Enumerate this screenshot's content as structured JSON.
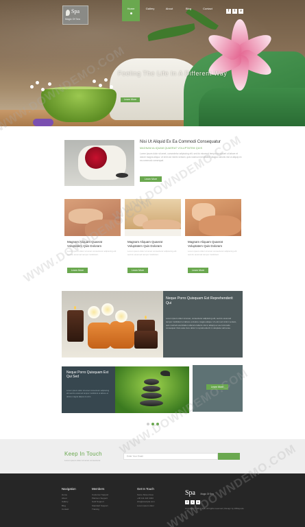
{
  "brand": {
    "name": "Spa",
    "tagline": "Magic Of Sea"
  },
  "nav": [
    {
      "label": "Home"
    },
    {
      "label": "Gallery"
    },
    {
      "label": "About"
    },
    {
      "label": "Blog"
    },
    {
      "label": "Contact"
    }
  ],
  "social": [
    "f",
    "t",
    "v"
  ],
  "hero": {
    "title": "Feeling The Life In A Different Way",
    "button": "Learn More"
  },
  "feature": {
    "title": "Nisi Ut Aliquid Ex Ea Commodi Consequatur",
    "subtitle": "MAGNAM ALIQUAM QUAERAT VOLUPTATEM QUIS",
    "text": "Lorem ipsum dolor sit amet, consectetur adipiscing elit, sed do eiusmod tempor incididunt ut labore et dolore magna aliqua. Ut enim ad minim veniam, quis nostrud exercitation ullamco laboris nisi ut aliquip ex ea commodo consequat.",
    "button": "Learn More"
  },
  "cards": [
    {
      "title": "Magnam Aliquam Quaerat Voluptatem Quis Doloram",
      "text": "Lorem ipsum dolor sit amet consectetur adipiscing elit sed do eiusmod tempor incididunt.",
      "button": "Learn More"
    },
    {
      "title": "Magnam Aliquam Quaerat Voluptatem Quis Doloram",
      "text": "Lorem ipsum dolor sit amet consectetur adipiscing elit sed do eiusmod tempor incididunt.",
      "button": "Learn More"
    },
    {
      "title": "Magnam Aliquam Quaerat Voluptatem Quis Doloram",
      "text": "Lorem ipsum dolor sit amet consectetur adipiscing elit sed do eiusmod tempor incididunt.",
      "button": "Learn More"
    }
  ],
  "big_feature": {
    "title": "Neque Porro Quisquam Est Reprehenderit Qui",
    "text": "Lorem ipsum dolor sit amet, consectetur adipiscing elit, sed do eiusmod tempor incididunt ut labore et dolore magna aliqua. Ut enim ad minim veniam, quis nostrud exercitation ullamco laboris nisi ut aliquip ex ea commodo consequat. Duis aute irure dolor in reprehenderit in voluptate velit esse."
  },
  "triple": {
    "title": "Neque Porro Quisquam Est Qui Sed",
    "text": "Lorem ipsum dolor sit amet consectetur adipiscing elit sed do eiusmod tempor incididunt ut labore et dolore magna aliqua ut enim.",
    "button": "Learn More"
  },
  "newsletter": {
    "title": "Keep In Touch",
    "subtitle": "Lorem ipsum dolor sit amet consectetur",
    "placeholder": "Enter Your Email"
  },
  "footer": {
    "navigation": {
      "heading": "Navigation",
      "links": [
        "Home",
        "About",
        "Gallery",
        "Blog",
        "Contact"
      ]
    },
    "members": {
      "heading": "Members",
      "links": [
        "Customer Support",
        "Platinum Support",
        "Gold Support",
        "Standard Support",
        "Training"
      ]
    },
    "touch": {
      "heading": "Get In Touch",
      "links": [
        "Some Street Area",
        "+00 111 222 3333",
        "info@example.com",
        "Lorem ipsum dolor"
      ]
    },
    "brand_name": "Spa",
    "brand_tag": "Magic Of Sea",
    "copyright": "Copyright © 2016 Spa. All rights reserved | Design by W3layouts"
  },
  "watermark": "WWW.DOWNDEMO.COM",
  "colors": {
    "accent": "#6aa84f",
    "footer": "#262626",
    "newsletter_bg": "#eeeeee"
  }
}
